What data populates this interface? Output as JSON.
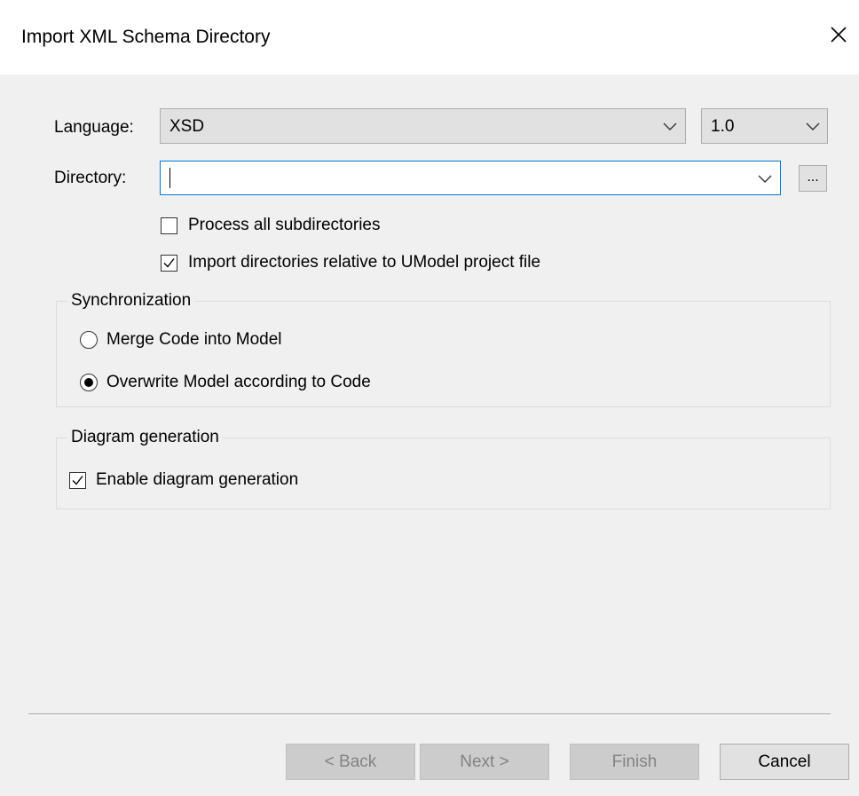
{
  "window": {
    "title": "Import XML Schema Directory",
    "close_icon": "close-icon"
  },
  "form": {
    "language_label": "Language:",
    "language_value": "XSD",
    "version_value": "1.0",
    "directory_label": "Directory:",
    "directory_value": "",
    "browse_label": "...",
    "process_subdirs_label": "Process all subdirectories",
    "process_subdirs_checked": false,
    "import_relative_label": "Import directories relative to UModel project file",
    "import_relative_checked": true
  },
  "synchronization": {
    "title": "Synchronization",
    "merge_label": "Merge Code into Model",
    "overwrite_label": "Overwrite Model according to Code",
    "selected": "overwrite"
  },
  "diagram": {
    "title": "Diagram generation",
    "enable_label": "Enable diagram generation",
    "enable_checked": true
  },
  "buttons": {
    "back": "< Back",
    "next": "Next >",
    "finish": "Finish",
    "cancel": "Cancel"
  },
  "colors": {
    "focus_border": "#0078d7",
    "dialog_background": "#f0f0f0",
    "disabled_text": "#838383"
  }
}
